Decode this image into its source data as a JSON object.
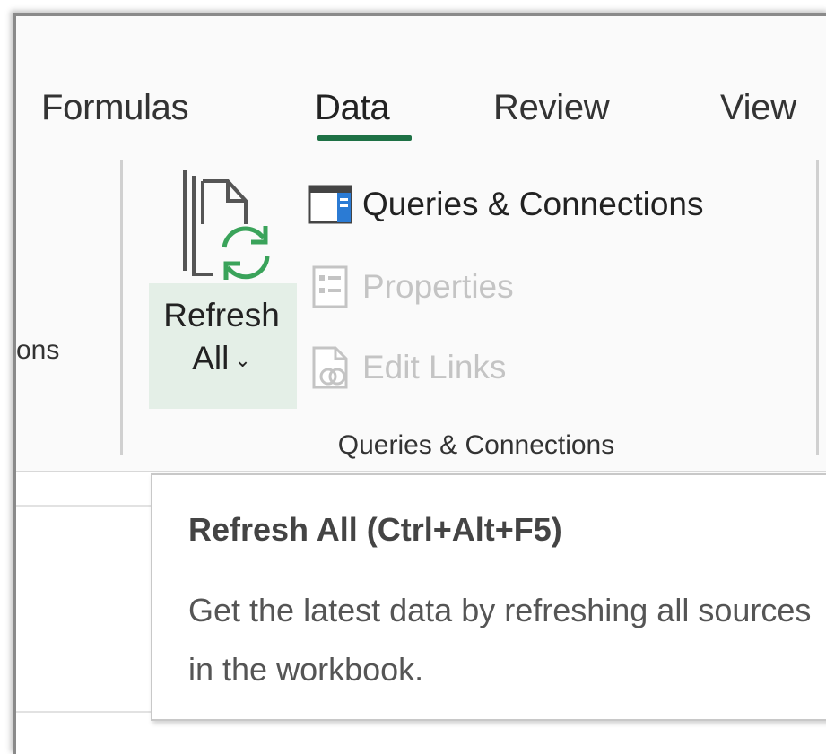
{
  "tabs": [
    {
      "label": "Formulas"
    },
    {
      "label": "Data"
    },
    {
      "label": "Review"
    },
    {
      "label": "View"
    }
  ],
  "ribbon": {
    "clipped_label": "ons",
    "refresh_all": {
      "line1": "Refresh",
      "line2": "All",
      "chevron": "⌄",
      "icon": "refresh-all-icon"
    },
    "commands": [
      {
        "label": "Queries & Connections",
        "icon": "queries-connections-icon",
        "enabled": true
      },
      {
        "label": "Properties",
        "icon": "properties-icon",
        "enabled": false
      },
      {
        "label": "Edit Links",
        "icon": "edit-links-icon",
        "enabled": false
      }
    ],
    "group_label": "Queries & Connections"
  },
  "tooltip": {
    "title": "Refresh All (Ctrl+Alt+F5)",
    "body": "Get the latest data by refreshing all sources in the workbook."
  },
  "colors": {
    "accent": "#1e7145",
    "refresh_green": "#3aa35a",
    "hover_bg": "#e4efe7",
    "disabled": "#c4c4c4"
  }
}
